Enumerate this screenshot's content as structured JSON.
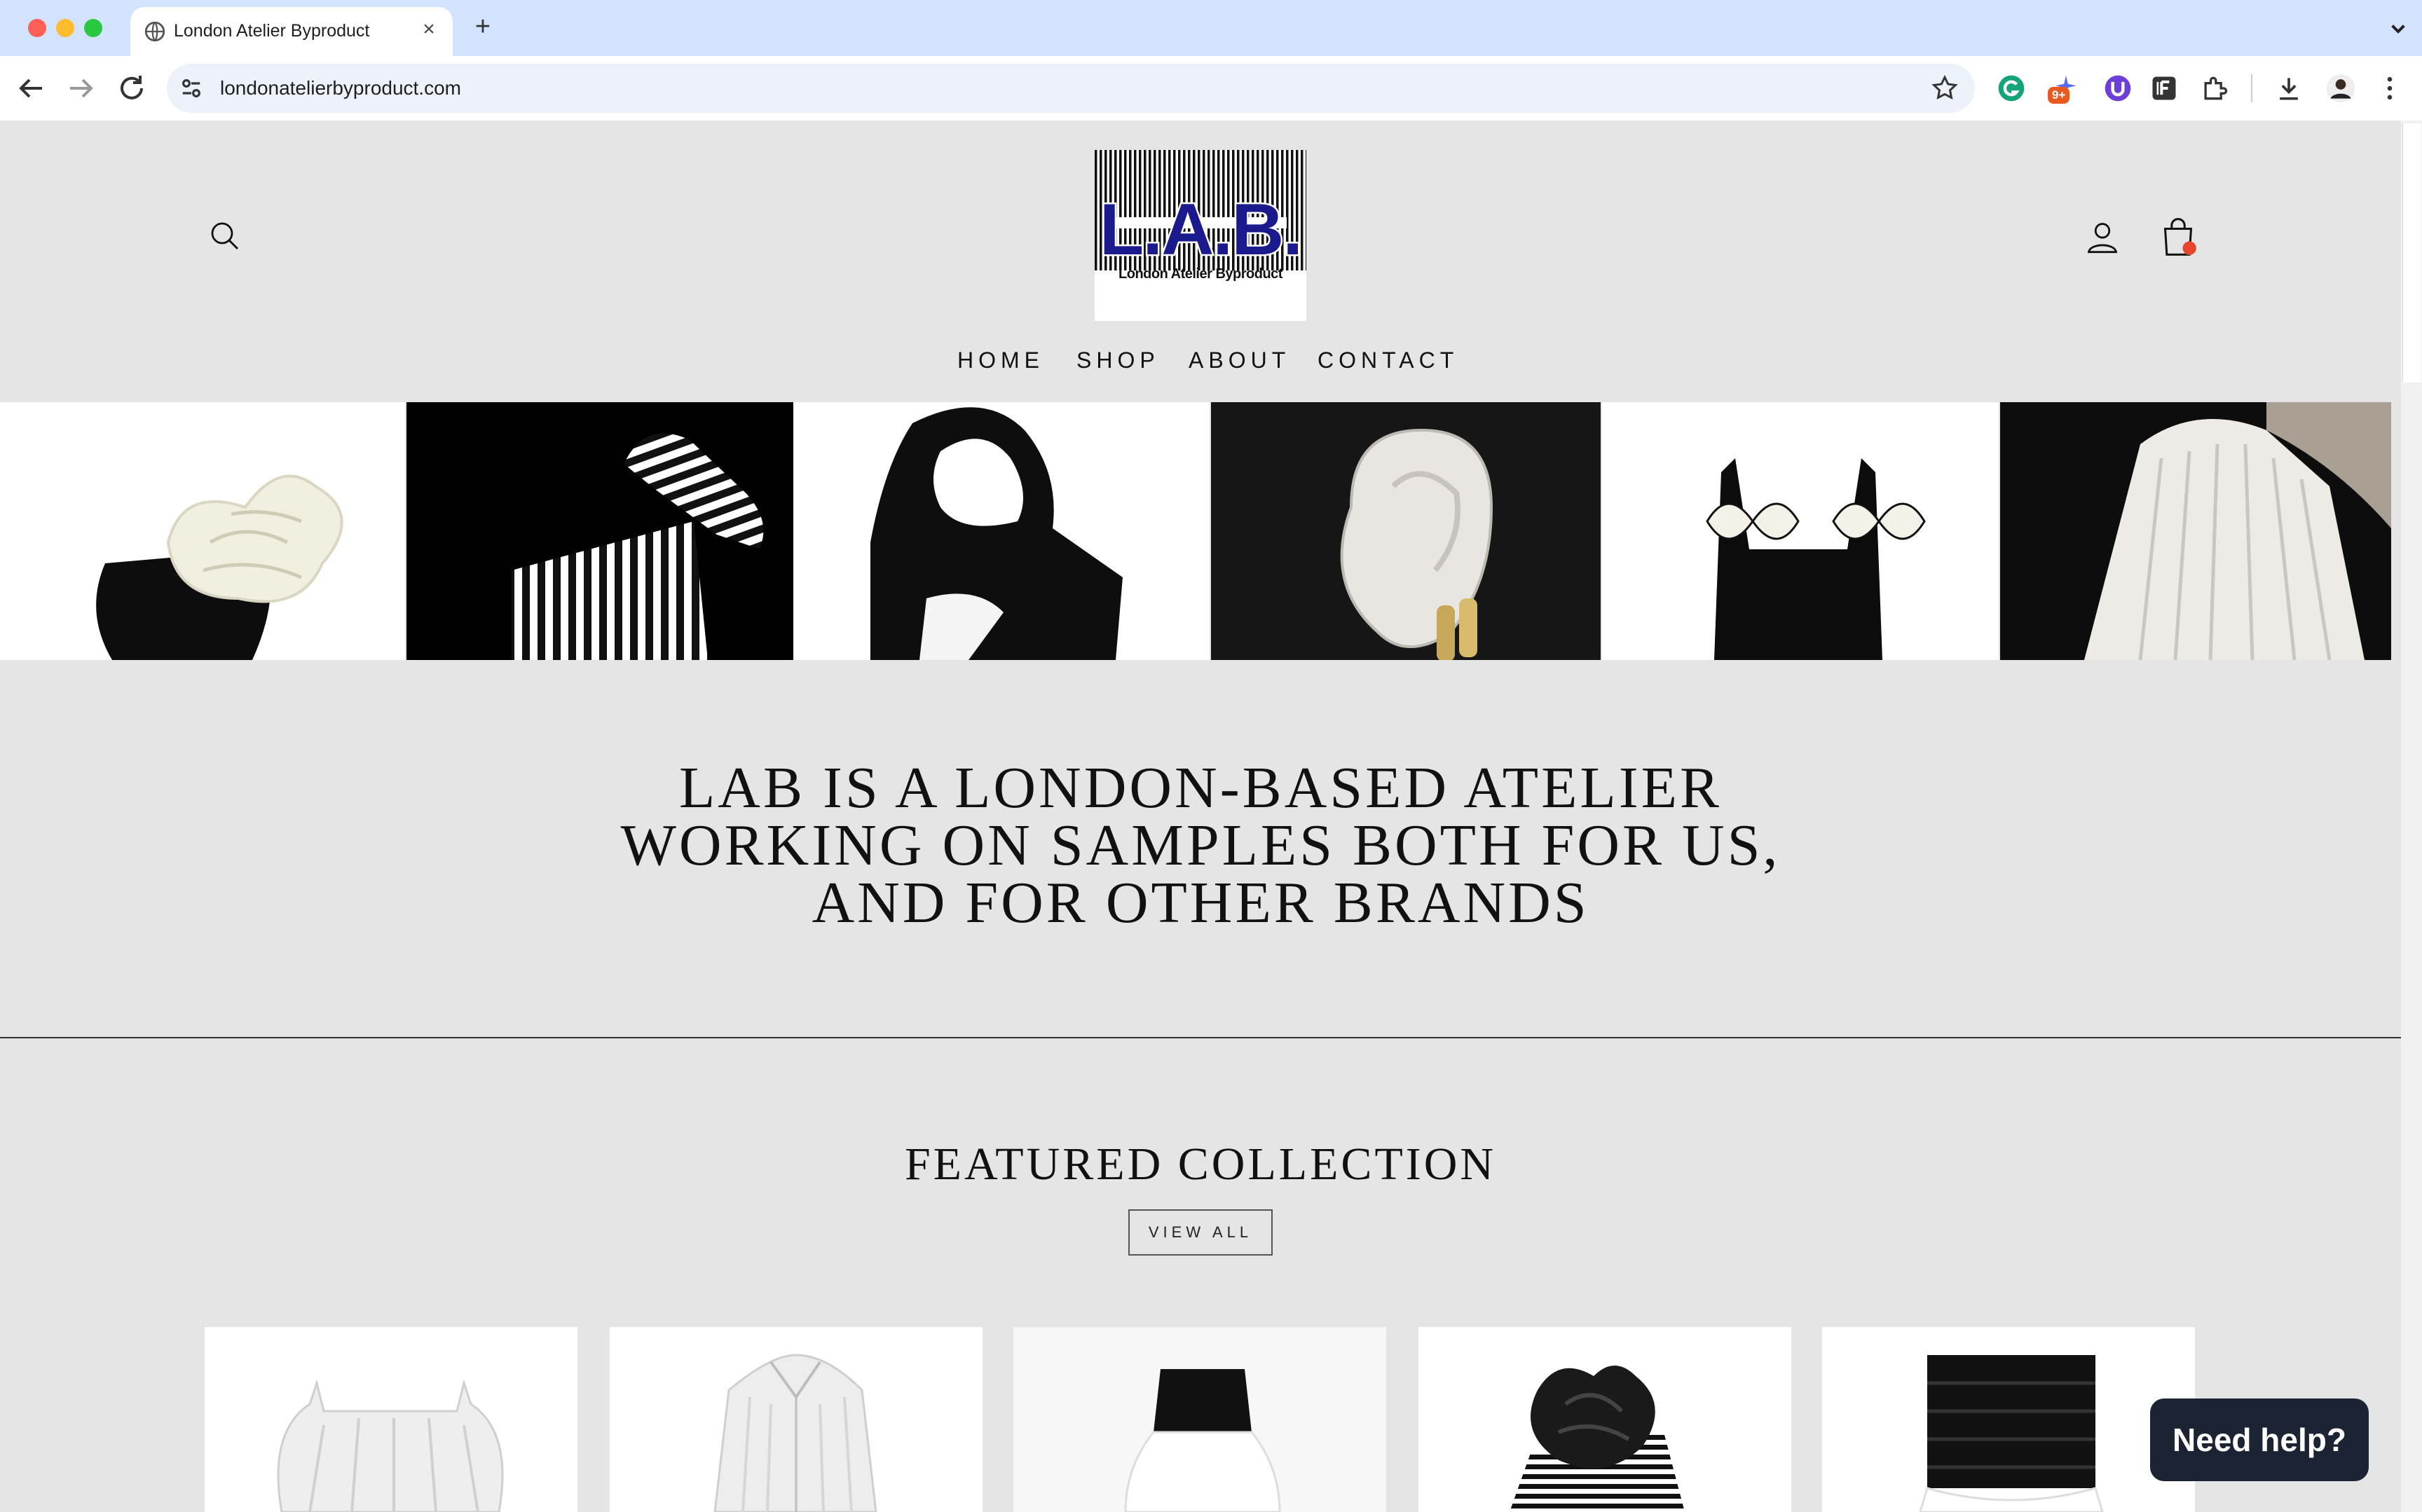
{
  "browser": {
    "tab_title": "London Atelier Byproduct",
    "url": "londonatelierbyproduct.com",
    "extension_badge": "9+"
  },
  "site": {
    "logo": {
      "letters": "L.A.B.",
      "subtitle": "London Atelier Byproduct"
    },
    "nav": [
      {
        "label": "HOME"
      },
      {
        "label": "SHOP"
      },
      {
        "label": "ABOUT"
      },
      {
        "label": "CONTACT"
      }
    ],
    "tagline": {
      "line1": "LAB IS A LONDON-BASED ATELIER",
      "line2": "WORKING ON SAMPLES BOTH FOR US,",
      "line3": "AND FOR OTHER BRANDS"
    },
    "featured": {
      "title": "FEATURED COLLECTION",
      "view_all": "VIEW ALL"
    },
    "chat": {
      "label": "Need help?"
    }
  },
  "colors": {
    "page_bg": "#e5e5e5",
    "logo_text": "#1a1a8c",
    "chat_bg": "#1c2333",
    "cart_dot": "#e8452c"
  }
}
